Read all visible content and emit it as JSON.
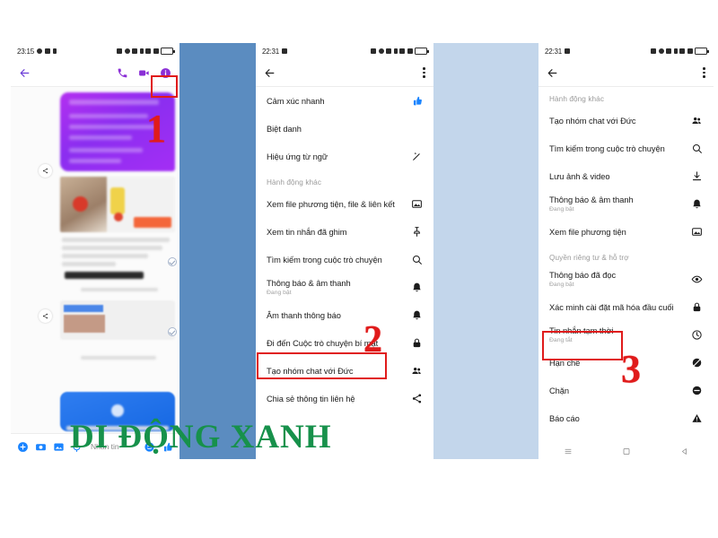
{
  "watermark": {
    "text": "DI ĐỘNG XANH",
    "color": "#17914b"
  },
  "panels": {
    "left": {
      "status": {
        "time": "23:15"
      },
      "appbar": {
        "back": "back-arrow",
        "call": "phone-icon",
        "video": "video-camera-icon",
        "info": "info-icon"
      },
      "composer": {
        "placeholder": "Nhắn tin",
        "add": "plus-circle-icon",
        "camera": "camera-icon",
        "gallery": "gallery-icon",
        "mic": "microphone-icon",
        "sticker": "sticker-icon",
        "like": "thumbs-up-icon"
      },
      "annotation": "1"
    },
    "mid": {
      "status": {
        "time": "22:31"
      },
      "annotation": "2",
      "items": [
        {
          "label": "Cảm xúc nhanh",
          "sub": "",
          "icon": "thumbs-up-icon",
          "section": ""
        },
        {
          "label": "Biệt danh",
          "sub": "",
          "icon": "",
          "section": ""
        },
        {
          "label": "Hiệu ứng từ ngữ",
          "sub": "",
          "icon": "magic-wand-icon",
          "section": ""
        },
        {
          "label": "Xem file phương tiện, file & liên kết",
          "sub": "",
          "icon": "image-icon",
          "section": "Hành động khác"
        },
        {
          "label": "Xem tin nhắn đã ghim",
          "sub": "",
          "icon": "pin-icon",
          "section": ""
        },
        {
          "label": "Tìm kiếm trong cuộc trò chuyện",
          "sub": "",
          "icon": "search-icon",
          "section": ""
        },
        {
          "label": "Thông báo & âm thanh",
          "sub": "Đang bật",
          "icon": "bell-icon",
          "section": ""
        },
        {
          "label": "Âm thanh thông báo",
          "sub": "",
          "icon": "bell-icon",
          "section": ""
        },
        {
          "label": "Đi đến Cuộc trò chuyện bí mật",
          "sub": "",
          "icon": "lock-icon",
          "section": ""
        },
        {
          "label": "Tạo nhóm chat với Đức",
          "sub": "",
          "icon": "people-icon",
          "section": ""
        },
        {
          "label": "Chia sẻ thông tin liên hệ",
          "sub": "",
          "icon": "share-icon",
          "section": ""
        }
      ]
    },
    "right": {
      "status": {
        "time": "22:31"
      },
      "annotation": "3",
      "items": [
        {
          "label": "Tạo nhóm chat với Đức",
          "sub": "",
          "icon": "people-icon",
          "section": "Hành động khác"
        },
        {
          "label": "Tìm kiếm trong cuộc trò chuyện",
          "sub": "",
          "icon": "search-icon",
          "section": ""
        },
        {
          "label": "Lưu ảnh & video",
          "sub": "",
          "icon": "download-icon",
          "section": ""
        },
        {
          "label": "Thông báo & âm thanh",
          "sub": "Đang bật",
          "icon": "bell-icon",
          "section": ""
        },
        {
          "label": "Xem file phương tiện",
          "sub": "",
          "icon": "image-icon",
          "section": ""
        },
        {
          "label": "Thông báo đã đọc",
          "sub": "Đang bật",
          "icon": "eye-icon",
          "section": "Quyền riêng tư & hỗ trợ"
        },
        {
          "label": "Xác minh cài đặt mã hóa đầu cuối",
          "sub": "",
          "icon": "lock-icon",
          "section": ""
        },
        {
          "label": "Tin nhắn tạm thời",
          "sub": "Đang tắt",
          "icon": "clock-icon",
          "section": ""
        },
        {
          "label": "Hạn chế",
          "sub": "",
          "icon": "restrict-icon",
          "section": ""
        },
        {
          "label": "Chặn",
          "sub": "",
          "icon": "block-icon",
          "section": ""
        },
        {
          "label": "Báo cáo",
          "sub": "",
          "icon": "warning-icon",
          "section": ""
        }
      ]
    }
  }
}
